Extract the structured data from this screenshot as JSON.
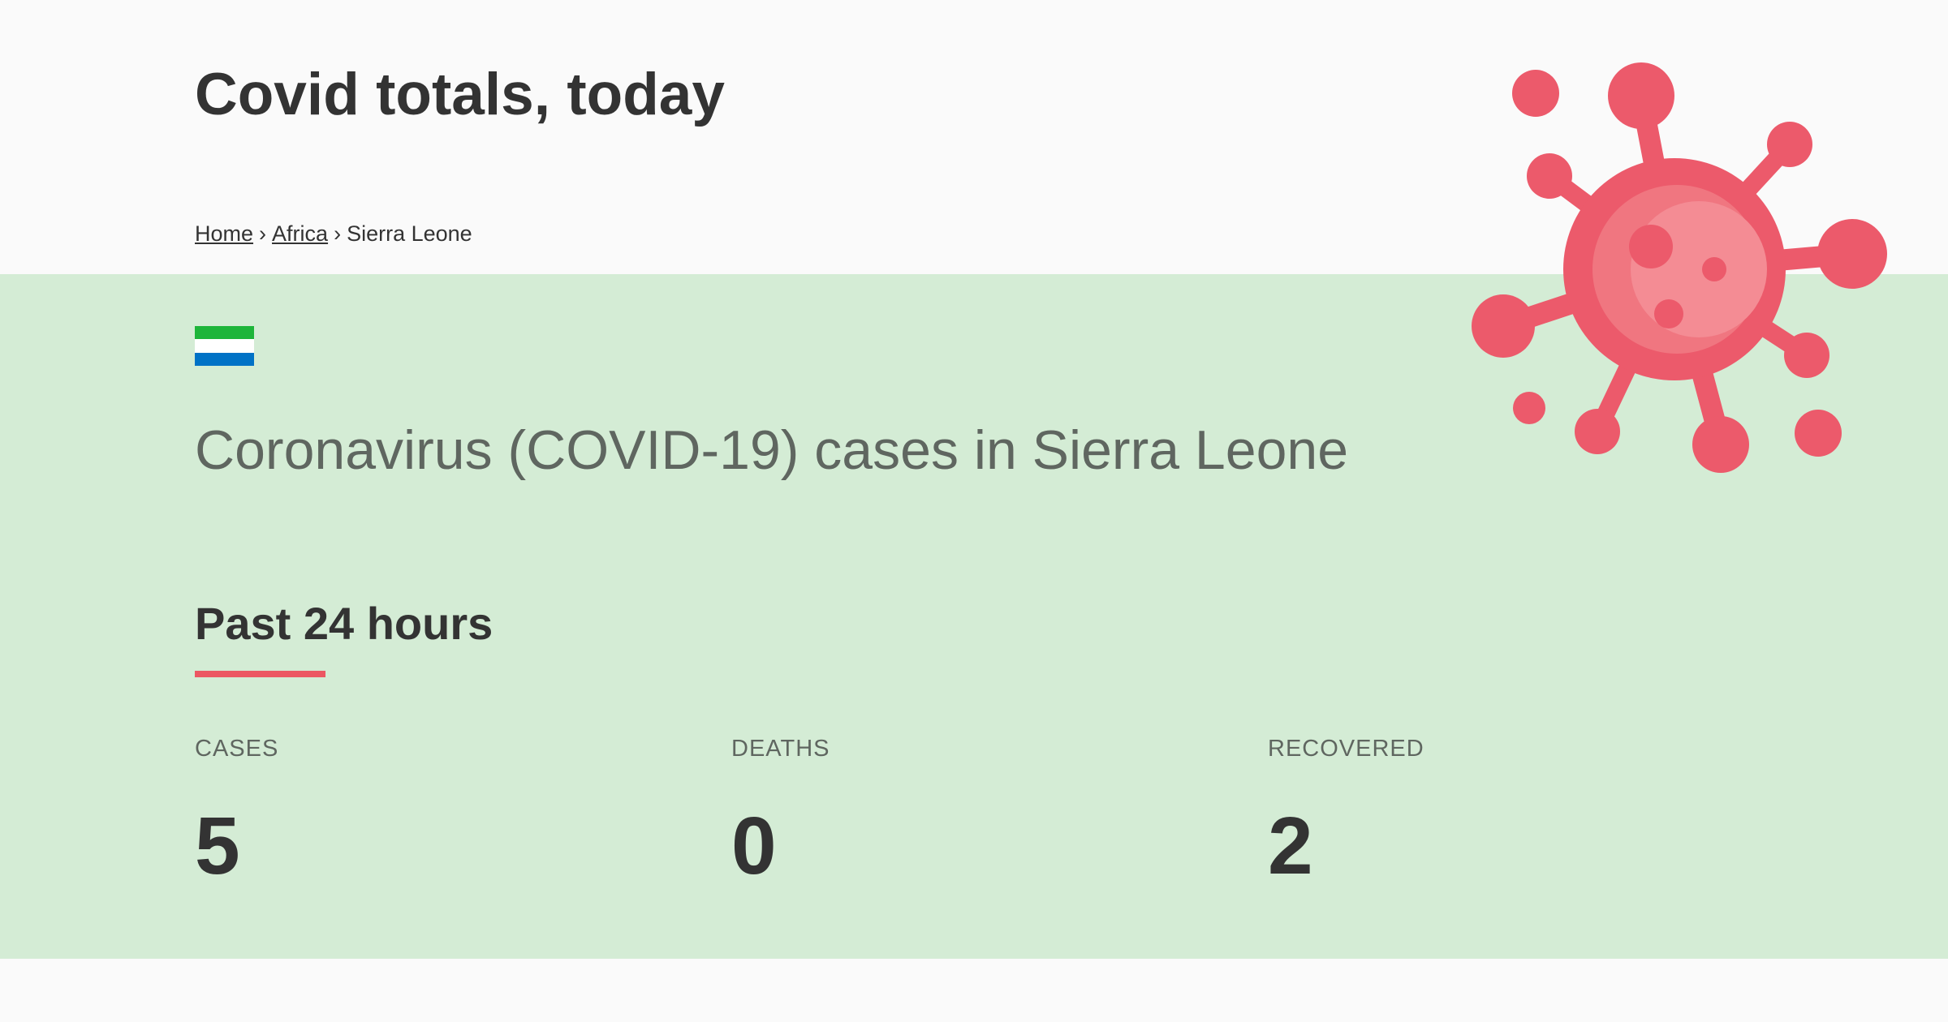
{
  "header": {
    "title": "Covid totals, today",
    "breadcrumb": {
      "home": "Home",
      "separator": "›",
      "region": "Africa",
      "current": "Sierra Leone"
    }
  },
  "country": {
    "flag_icon": "sierra-leone-flag-icon",
    "flag_colors": [
      "#1eb53a",
      "#ffffff",
      "#0072c6"
    ],
    "heading": "Coronavirus (COVID-19) cases in Sierra Leone"
  },
  "period": {
    "title": "Past 24 hours"
  },
  "stats": [
    {
      "label": "CASES",
      "value": "5"
    },
    {
      "label": "DEATHS",
      "value": "0"
    },
    {
      "label": "RECOVERED",
      "value": "2"
    }
  ],
  "colors": {
    "band_background": "#d4ecd5",
    "accent": "#ec5762",
    "virus": "#ec5a6b",
    "virus_highlight": "#f48c94"
  },
  "decoration": {
    "virus_icon": "virus-icon"
  }
}
